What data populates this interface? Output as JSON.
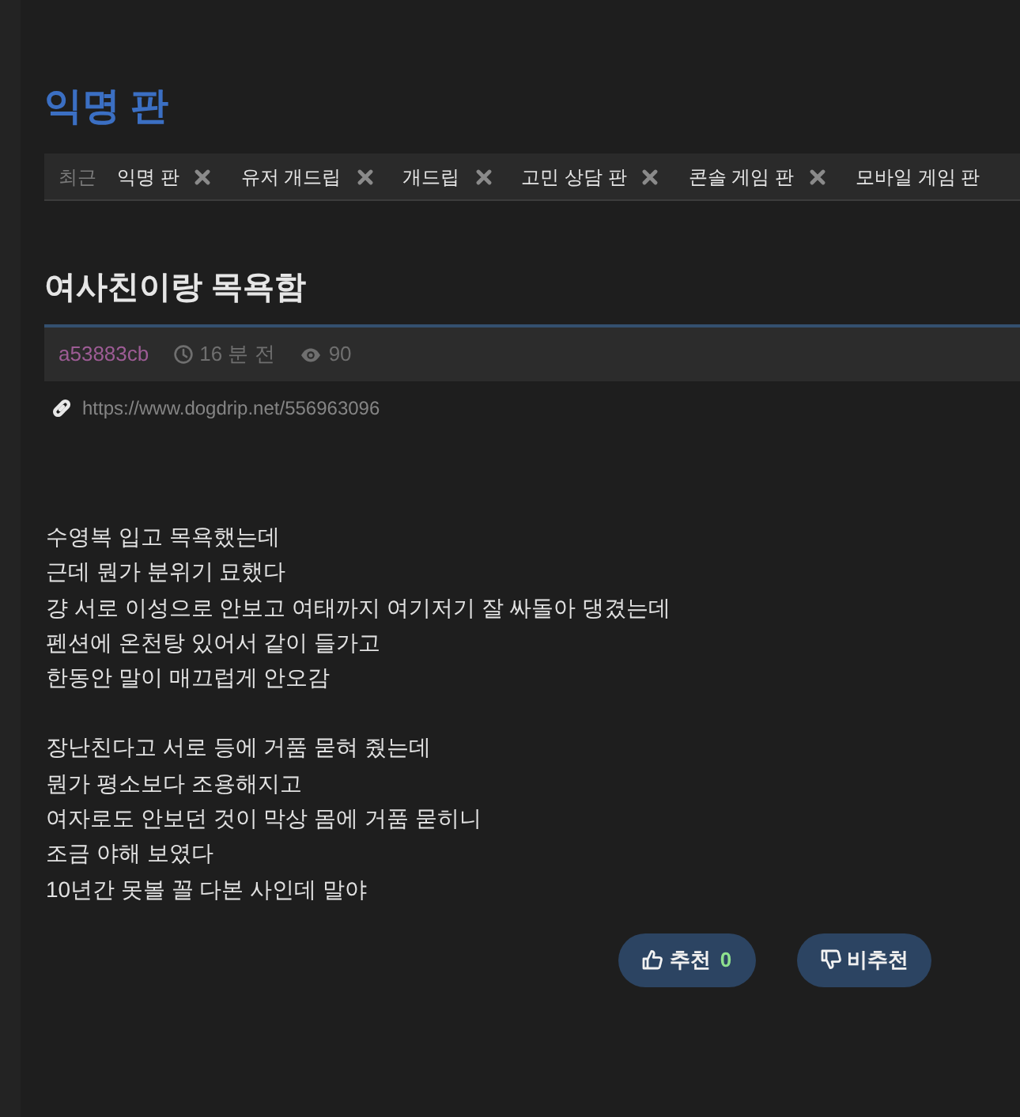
{
  "board": {
    "title": "익명 판"
  },
  "recent_bar": {
    "label": "최근",
    "items": [
      {
        "label": "익명 판",
        "removable": true
      },
      {
        "label": "유저 개드립",
        "removable": true
      },
      {
        "label": "개드립",
        "removable": true
      },
      {
        "label": "고민 상담 판",
        "removable": true
      },
      {
        "label": "콘솔 게임 판",
        "removable": true
      },
      {
        "label": "모바일 게임 판",
        "removable": false
      }
    ]
  },
  "post": {
    "title": "여사친이랑 목욕함",
    "author": "a53883cb",
    "time": "16 분 전",
    "views": "90",
    "url": "https://www.dogdrip.net/556963096",
    "paragraphs": [
      [
        "수영복 입고 목욕했는데",
        "근데 뭔가 분위기 묘했다",
        "걍 서로 이성으로 안보고 여태까지 여기저기 잘 싸돌아 댕겼는데",
        "펜션에 온천탕 있어서 같이 들가고",
        "한동안 말이 매끄럽게 안오감"
      ],
      [
        "장난친다고 서로 등에 거품 묻혀 줬는데",
        "뭔가 평소보다 조용해지고",
        "여자로도 안보던 것이 막상 몸에 거품 묻히니",
        "조금 야해 보였다",
        "10년간 못볼 꼴 다본 사인데 말야"
      ]
    ]
  },
  "votes": {
    "upvote": {
      "label": "추천",
      "count": "0"
    },
    "downvote": {
      "label": "비추천"
    }
  }
}
